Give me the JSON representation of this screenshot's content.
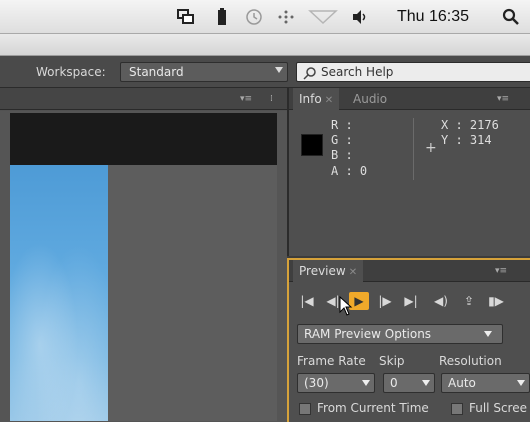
{
  "menubar": {
    "icons": [
      "display-mirror-icon",
      "battery-icon",
      "time-machine-icon",
      "bluetooth-icon",
      "wifi-icon",
      "volume-icon",
      "spotlight-icon"
    ],
    "clock": "Thu 16:35"
  },
  "header": {
    "workspace_label": "Workspace:",
    "workspace_value": "Standard",
    "search_placeholder": "Search Help"
  },
  "info": {
    "tabs": [
      "Info",
      "Audio"
    ],
    "swatch_color": "#000000",
    "r_label": "R :",
    "g_label": "G :",
    "b_label": "B :",
    "a_label": "A : 0",
    "x_label": "X : 2176",
    "y_label": "Y : 314"
  },
  "preview": {
    "tab": "Preview",
    "controls": [
      "first-frame-icon",
      "previous-frame-icon",
      "play-icon",
      "next-frame-icon",
      "last-frame-icon",
      "audio-icon",
      "loop-icon",
      "ram-preview-icon"
    ],
    "options_dropdown": "RAM Preview Options",
    "frame_rate_label": "Frame Rate",
    "skip_label": "Skip",
    "resolution_label": "Resolution",
    "frame_rate_value": "(30)",
    "skip_value": "0",
    "resolution_value": "Auto",
    "from_current_time": "From Current Time",
    "full_screen": "Full Scree"
  }
}
